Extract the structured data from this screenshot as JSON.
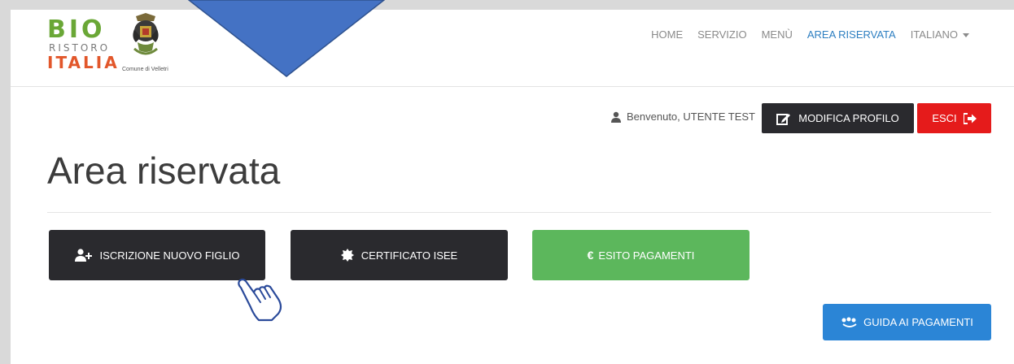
{
  "logo": {
    "line1": "BIO",
    "line2": "RISTORO",
    "line3": "ITALIA",
    "comune": "Comune di Velletri",
    "crest_icon": "crest-icon"
  },
  "nav": {
    "items": [
      {
        "label": "HOME",
        "active": false
      },
      {
        "label": "SERVIZIO",
        "active": false
      },
      {
        "label": "MENÙ",
        "active": false
      },
      {
        "label": "AREA RISERVATA",
        "active": true
      },
      {
        "label": "ITALIANO",
        "active": false,
        "dropdown": true
      }
    ]
  },
  "user": {
    "welcome": "Benvenuto, UTENTE TEST",
    "modifica_label": "MODIFICA PROFILO",
    "esci_label": "ESCI"
  },
  "page": {
    "title": "Area riservata"
  },
  "actions": {
    "iscrizione_label": "ISCRIZIONE NUOVO FIGLIO",
    "isee_label": "CERTIFICATO ISEE",
    "esito_label": "ESITO PAGAMENTI",
    "guida_label": "GUIDA AI PAGAMENTI"
  },
  "colors": {
    "accent": "#2e7fc1",
    "dark_button": "#2a2a2e",
    "red_button": "#e51b1b",
    "green_button": "#5cb75c",
    "blue_button": "#2b85d6",
    "triangle": "#4472c4"
  }
}
